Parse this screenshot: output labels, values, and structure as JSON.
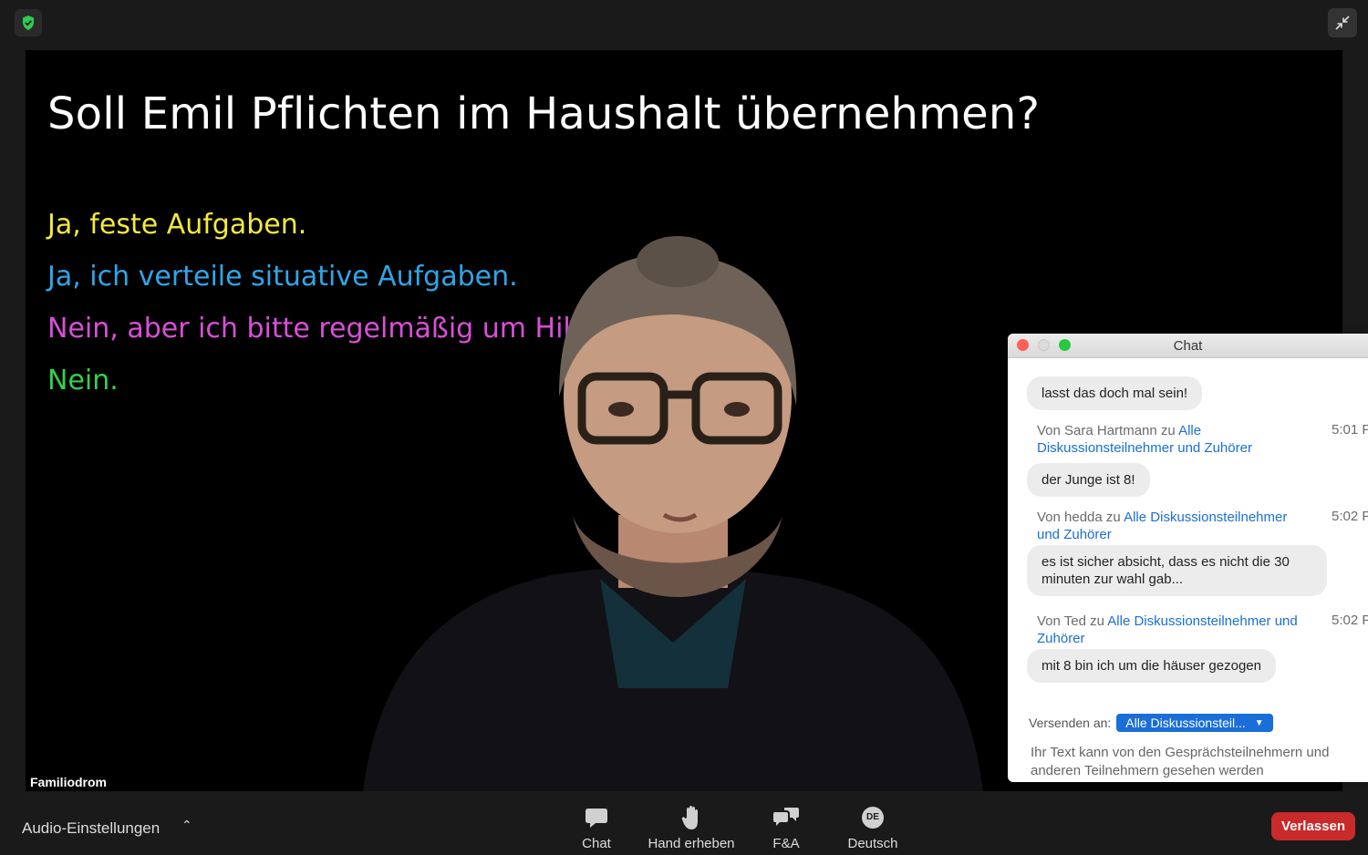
{
  "video": {
    "slide_title": "Soll Emil Pflichten im Haushalt übernehmen?",
    "options": [
      "Ja, feste Aufgaben.",
      "Ja, ich verteile situative Aufgaben.",
      "Nein, aber ich bitte regelmäßig um Hilfe.",
      "Nein."
    ],
    "speaker_name": "Familiodrom"
  },
  "chat": {
    "title": "Chat",
    "messages": [
      {
        "text": "lasst das doch mal sein!"
      },
      {
        "from": "Von Sara Hartmann zu ",
        "to": "Alle Diskussionsteilnehmer und Zuhörer",
        "time": "5:01 P",
        "text": "der Junge ist 8!"
      },
      {
        "from": "Von hedda zu ",
        "to": "Alle Diskussionsteilnehmer und Zuhörer",
        "time": "5:02 P",
        "text": "es ist sicher absicht, dass es nicht die 30 minuten zur wahl gab..."
      },
      {
        "from": "Von Ted zu ",
        "to": "Alle Diskussionsteilnehmer und Zuhörer",
        "time": "5:02 P",
        "text": "mit 8 bin ich um die häuser gezogen"
      }
    ],
    "send_to_label": "Versenden an:",
    "send_to_value": "Alle Diskussionsteil...",
    "input_placeholder": "Ihr Text kann von den Gesprächsteilnehmern und anderen Teilnehmern gesehen werden"
  },
  "toolbar": {
    "audio_settings": "Audio-Einstellungen",
    "chat": "Chat",
    "raise_hand": "Hand erheben",
    "qa": "F&A",
    "language": "Deutsch",
    "language_badge": "DE",
    "leave": "Verlassen"
  },
  "colors": {
    "leave_red": "#c92a2a",
    "link_blue": "#1a6ed8",
    "shield_green": "#2ecc4f"
  }
}
